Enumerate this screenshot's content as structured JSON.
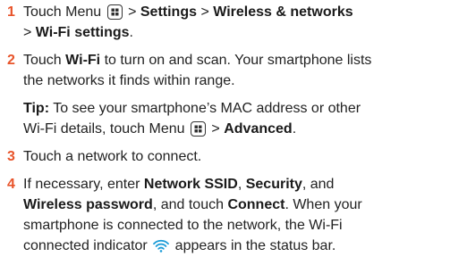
{
  "accent_color": "#e8542a",
  "steps": [
    {
      "number": "1",
      "l1a": "Touch Menu",
      "l1b": ">",
      "l1c": "Settings",
      "l1d": ">",
      "l1e": "Wireless & networks",
      "l2a": ">",
      "l2b": "Wi-Fi settings",
      "l2c": "."
    },
    {
      "number": "2",
      "l1a": "Touch",
      "l1b": "Wi-Fi",
      "l1c": "to turn on and scan. Your smartphone lists",
      "l2": "the networks it finds within range."
    },
    {
      "number": "3",
      "text": "Touch a network to connect."
    },
    {
      "number": "4",
      "l1a": "If necessary, enter",
      "l1b": "Network SSID",
      "l1c": ",",
      "l1d": "Security",
      "l1e": ", and",
      "l2a": "Wireless password",
      "l2b": ", and touch",
      "l2c": "Connect",
      "l2d": ". When your",
      "l3": "smartphone is connected to the network, the Wi-Fi",
      "l4a": "connected indicator",
      "l4b": "appears in the status bar."
    }
  ],
  "tip": {
    "label": "Tip:",
    "l1": "To see your smartphone’s MAC address or other",
    "l2a": "Wi-Fi details, touch Menu",
    "l2b": ">",
    "l2c": "Advanced",
    "l2d": "."
  },
  "icons": [
    "menu-key-icon",
    "wifi-connected-icon"
  ]
}
